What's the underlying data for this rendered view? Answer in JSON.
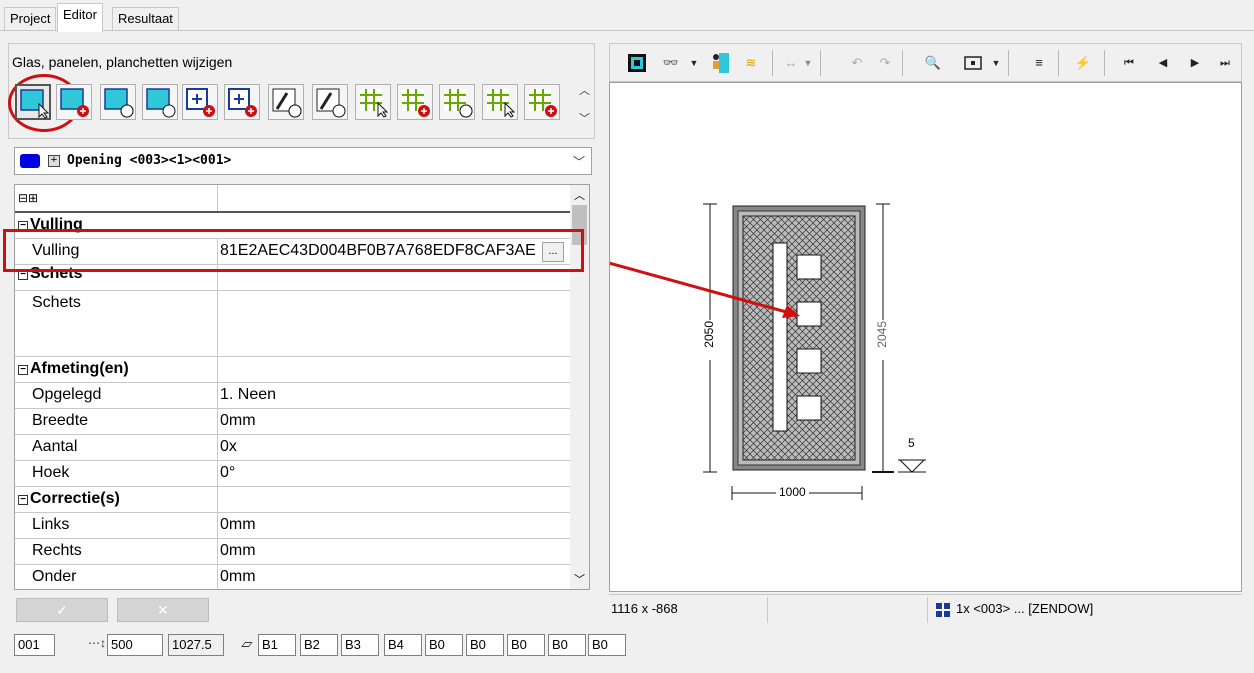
{
  "tabs": [
    "Project",
    "Editor",
    "Resultaat"
  ],
  "left": {
    "group_title": "Glas, panelen, planchetten wijzigen",
    "tool_icons": [
      "glass-select-icon",
      "glass-add-icon",
      "glass-remove-icon",
      "glass-move-icon",
      "panel-add-icon",
      "panel-horizontal-add-icon",
      "sash-remove-icon",
      "sash-move-icon",
      "grid-select-icon",
      "grid-add-icon",
      "grid-remove-icon",
      "grid-select2-icon",
      "grid-add2-icon"
    ],
    "combo_value": "Opening <003><1><001>",
    "grid_header_icons": "⊟⊞",
    "rows": {
      "vulling_cat": "Vulling",
      "vulling_lbl": "Vulling",
      "vulling_val": "81E2AEC43D004BF0B7A768EDF8CAF3AE",
      "vulling_btn": "...",
      "schets_cat": "Schets",
      "schets_lbl": "Schets",
      "afmeting_cat": "Afmeting(en)",
      "opgelegd_lbl": "Opgelegd",
      "opgelegd_val": "1. Neen",
      "breedte_lbl": "Breedte",
      "breedte_val": "0mm",
      "aantal_lbl": "Aantal",
      "aantal_val": "0x",
      "hoek_lbl": "Hoek",
      "hoek_val": "0°",
      "correctie_cat": "Correctie(s)",
      "links_lbl": "Links",
      "links_val": "0mm",
      "rechts_lbl": "Rechts",
      "rechts_val": "0mm",
      "onder_lbl": "Onder",
      "onder_val": "0mm"
    },
    "ok_label": "✓",
    "cancel_label": "✕"
  },
  "drawing": {
    "dim_left": "2050",
    "dim_right": "2045",
    "dim_bottom": "1000",
    "level": "5"
  },
  "status": {
    "coords": "1116 x -868",
    "selection": "1x <003> ... [ZENDOW]"
  },
  "bottom": {
    "f1": "001",
    "f2": "500",
    "f3": "1027.5",
    "codes": [
      "B1",
      "B2",
      "B3",
      "B4",
      "B0",
      "B0",
      "B0",
      "B0",
      "B0"
    ]
  },
  "colors": {
    "accent_red": "#d01010",
    "cyan": "#30c8d8",
    "blue": "#0000e0"
  }
}
